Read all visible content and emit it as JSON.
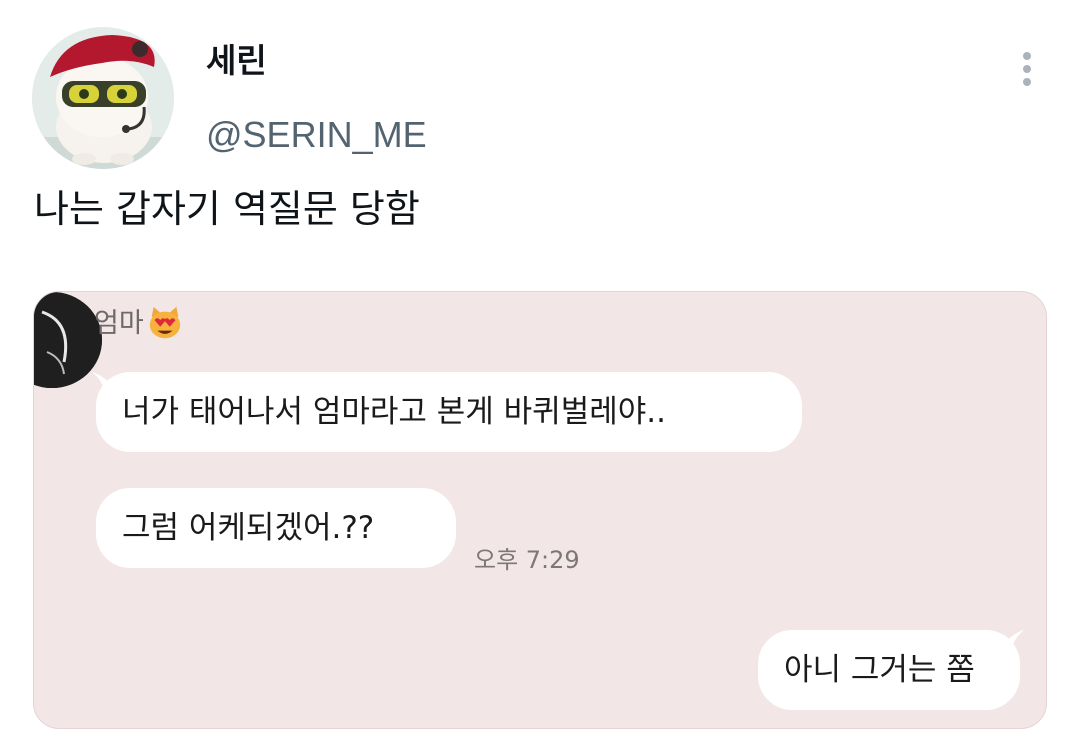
{
  "tweet": {
    "author_name": "세린",
    "author_handle": "@SERIN_ME",
    "text": "나는 갑자기 역질문 당함"
  },
  "chat": {
    "sender_name": "엄마",
    "sender_emoji": "heart-eyes-cat-emoji",
    "messages": [
      {
        "from": "other",
        "text": "너가 태어나서 엄마라고 본게 바퀴벌레야.."
      },
      {
        "from": "other",
        "text": "그럼 어케되겠어.??"
      },
      {
        "from": "me",
        "text": "아니 그거는 쫌"
      }
    ],
    "timestamp": "오후 7:29",
    "colors": {
      "background": "#f2e6e6",
      "bubble": "#ffffff"
    }
  },
  "icons": {
    "more": "more-vertical-icon"
  }
}
